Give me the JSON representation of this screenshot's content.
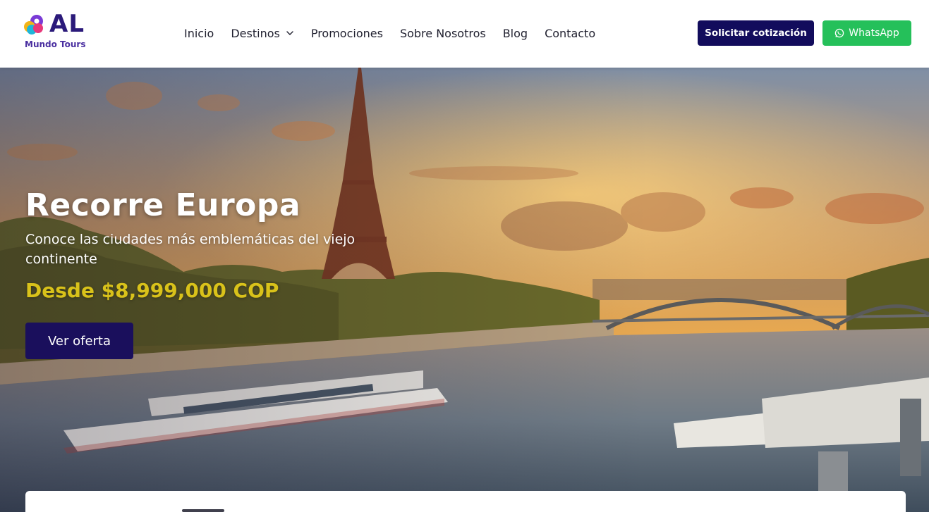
{
  "brand": {
    "logo_text": "AL",
    "logo_subtitle": "Mundo Tours"
  },
  "nav": {
    "items": [
      {
        "label": "Inicio",
        "has_dropdown": false
      },
      {
        "label": "Destinos",
        "has_dropdown": true
      },
      {
        "label": "Promociones",
        "has_dropdown": false
      },
      {
        "label": "Sobre Nosotros",
        "has_dropdown": false
      },
      {
        "label": "Blog",
        "has_dropdown": false
      },
      {
        "label": "Contacto",
        "has_dropdown": false
      }
    ]
  },
  "header_buttons": {
    "quote_label": "Solicitar cotización",
    "whatsapp_label": "WhatsApp"
  },
  "hero": {
    "title": "Recorre Europa",
    "subtitle": "Conoce las ciudades más emblemáticas del viejo continente",
    "price": "Desde $8,999,000 COP",
    "cta_label": "Ver oferta"
  },
  "colors": {
    "brand_navy": "#120c5c",
    "whatsapp_green": "#25c05a",
    "price_gold": "#d9c21a"
  },
  "icons": {
    "dropdown": "chevron-down-icon",
    "whatsapp": "whatsapp-icon"
  }
}
